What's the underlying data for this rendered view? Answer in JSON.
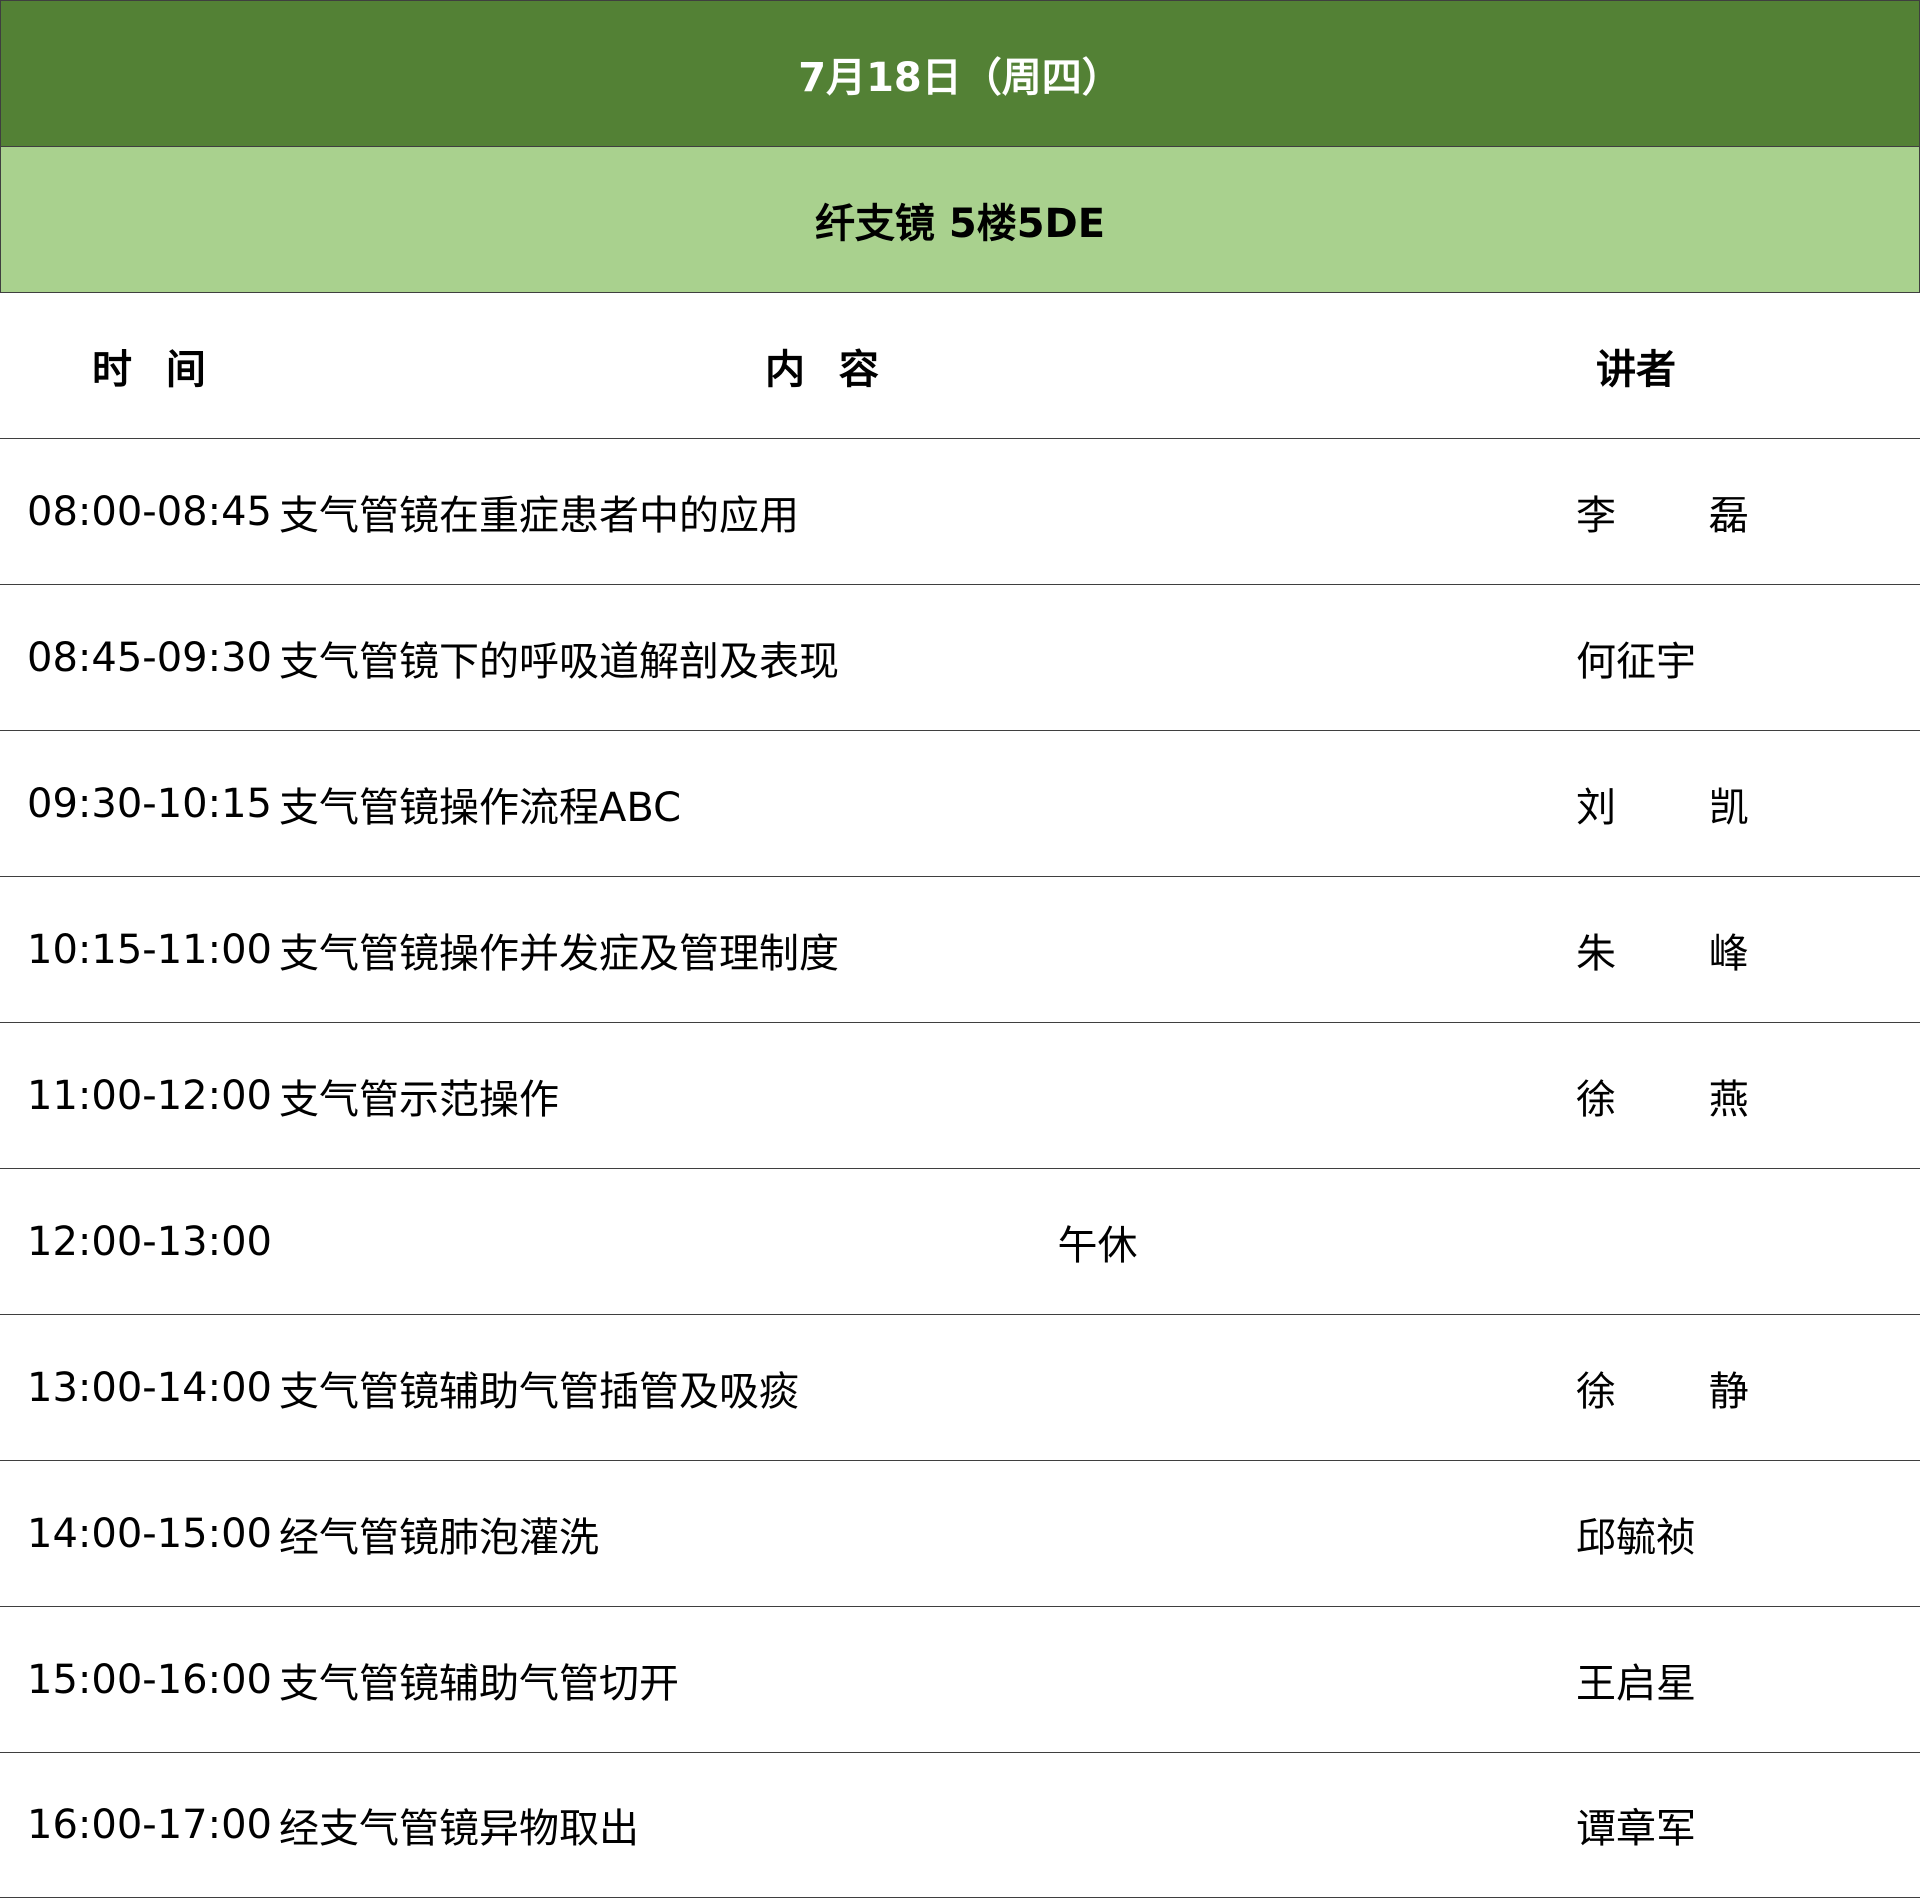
{
  "header": {
    "date": "7月18日（周四）",
    "room": "纤支镜 5楼5DE"
  },
  "columns": {
    "time": "时 间",
    "topic": "内 容",
    "speaker": "讲者"
  },
  "rows": [
    {
      "time": "08:00-08:45",
      "topic": "支气管镜在重症患者中的应用",
      "speaker": "李 磊"
    },
    {
      "time": "08:45-09:30",
      "topic": "支气管镜下的呼吸道解剖及表现",
      "speaker": "何征宇"
    },
    {
      "time": "09:30-10:15",
      "topic": "支气管镜操作流程ABC",
      "speaker": "刘 凯"
    },
    {
      "time": "10:15-11:00",
      "topic": "支气管镜操作并发症及管理制度",
      "speaker": "朱 峰"
    },
    {
      "time": "11:00-12:00",
      "topic": "支气管示范操作",
      "speaker": "徐 燕"
    },
    {
      "time": "12:00-13:00",
      "topic": "午休",
      "speaker": ""
    },
    {
      "time": "13:00-14:00",
      "topic": "支气管镜辅助气管插管及吸痰",
      "speaker": "徐 静"
    },
    {
      "time": "14:00-15:00",
      "topic": "经气管镜肺泡灌洗",
      "speaker": "邱毓祯"
    },
    {
      "time": "15:00-16:00",
      "topic": "支气管镜辅助气管切开",
      "speaker": "王启星"
    },
    {
      "time": "16:00-17:00",
      "topic": "经支气管镜异物取出",
      "speaker": "谭章军"
    }
  ]
}
